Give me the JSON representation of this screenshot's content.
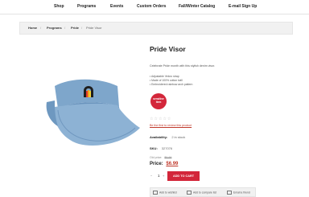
{
  "nav": {
    "items": [
      "Shop",
      "Programs",
      "Events",
      "Custom Orders",
      "Fall/Winter Catalog",
      "E-mail Sign Up"
    ]
  },
  "breadcrumb": [
    "Home",
    "Programs",
    "Pride",
    "Pride Visor"
  ],
  "product": {
    "title": "Pride Visor",
    "description": "Celebrate Pride month with this stylish denim visor.",
    "bullets": [
      "Adjustable Velcro strap",
      "Made of 100% cotton twill",
      "Embroidered rainbow arch pattern"
    ],
    "badge": "sensitive item",
    "stars": "☆☆☆☆☆",
    "review_link": "Be the first to review this product",
    "availability_label": "Availability:",
    "availability_value": "2 in stock",
    "sku_label": "SKU:",
    "sku_value": "327076",
    "old_price_label": "Old price:",
    "old_price_value": "$9.99",
    "price_label": "Price:",
    "price_value": "$6.99",
    "qty": "1",
    "qty_minus": "−",
    "qty_plus": "+",
    "add_to_cart": "ADD TO CART"
  },
  "actions": [
    "Add to wishlist",
    "Add to compare list",
    "Email a friend"
  ]
}
